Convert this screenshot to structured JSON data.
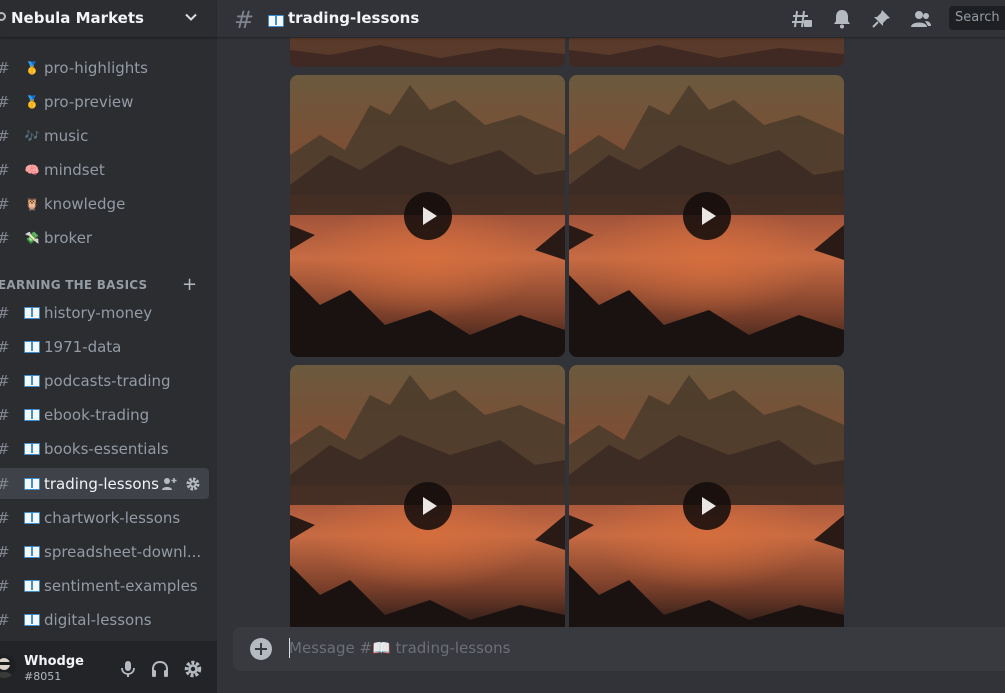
{
  "server": {
    "name": "Nebula Markets"
  },
  "channels_top": [
    {
      "emoji": "🥇",
      "name": "pro-highlights"
    },
    {
      "emoji": "🥇",
      "name": "pro-preview"
    },
    {
      "emoji": "🎶",
      "name": "music"
    },
    {
      "emoji": "🧠",
      "name": "mindset"
    },
    {
      "emoji": "🦉",
      "name": "knowledge"
    },
    {
      "emoji": "💸",
      "name": "broker"
    }
  ],
  "category": {
    "label": "EARNING THE BASICS"
  },
  "channels_basics": [
    {
      "name": "history-money"
    },
    {
      "name": "1971-data"
    },
    {
      "name": "podcasts-trading"
    },
    {
      "name": "ebook-trading"
    },
    {
      "name": "books-essentials"
    },
    {
      "name": "trading-lessons",
      "active": true
    },
    {
      "name": "chartwork-lessons"
    },
    {
      "name": "spreadsheet-downl..."
    },
    {
      "name": "sentiment-examples"
    },
    {
      "name": "digital-lessons"
    }
  ],
  "topbar": {
    "channel_title": "trading-lessons",
    "search_placeholder": "Search"
  },
  "composer": {
    "placeholder": "Message #📖 trading-lessons"
  },
  "user": {
    "name": "Whodge",
    "tag": "#8051"
  }
}
